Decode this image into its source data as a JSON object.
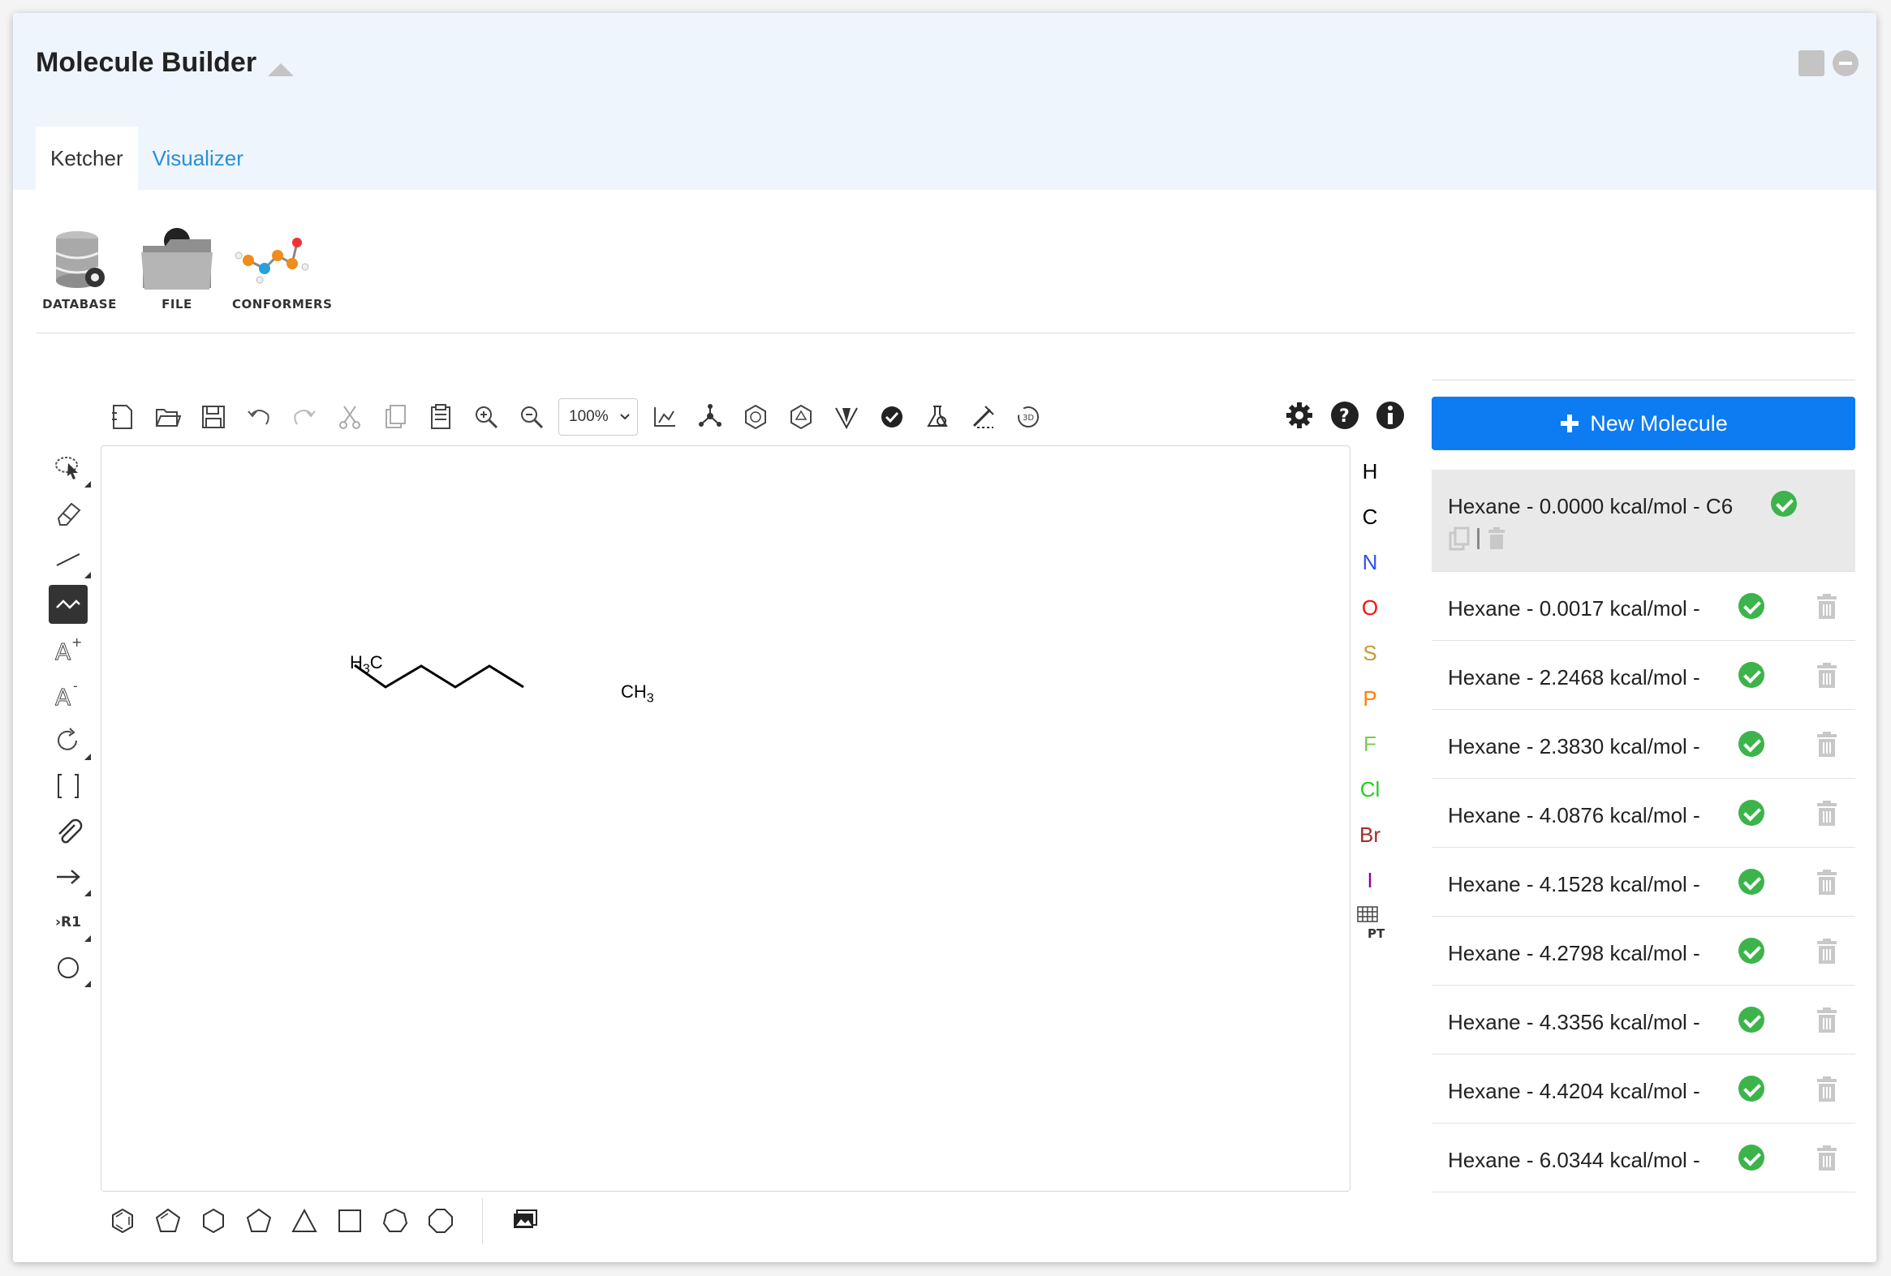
{
  "window": {
    "title": "Molecule Builder"
  },
  "tabs": [
    {
      "label": "Ketcher"
    },
    {
      "label": "Visualizer"
    }
  ],
  "top_icons": [
    {
      "label": "DATABASE"
    },
    {
      "label": "FILE"
    },
    {
      "label": "CONFORMERS"
    }
  ],
  "toolbar": {
    "zoom_value": "100%"
  },
  "canvas": {
    "left_label_main": "H",
    "left_label_sub": "3",
    "left_label_tail": "C",
    "right_label_main": "CH",
    "right_label_sub": "3"
  },
  "left_tools": {
    "rgroup_label": "R1"
  },
  "atoms": [
    {
      "symbol": "H",
      "color": "#000000"
    },
    {
      "symbol": "C",
      "color": "#000000"
    },
    {
      "symbol": "N",
      "color": "#304ff7"
    },
    {
      "symbol": "O",
      "color": "#ff0d0d"
    },
    {
      "symbol": "S",
      "color": "#c99a2e"
    },
    {
      "symbol": "P",
      "color": "#ff8000"
    },
    {
      "symbol": "F",
      "color": "#78cc50"
    },
    {
      "symbol": "Cl",
      "color": "#1fd01f"
    },
    {
      "symbol": "Br",
      "color": "#a62929"
    },
    {
      "symbol": "I",
      "color": "#940094"
    }
  ],
  "periodic_table_label": "PT",
  "panel": {
    "new_button": "New Molecule",
    "molecules": [
      {
        "label": "Hexane - 0.0000 kcal/mol - C6",
        "selected": true
      },
      {
        "label": "Hexane - 0.0017 kcal/mol -"
      },
      {
        "label": "Hexane - 2.2468 kcal/mol -"
      },
      {
        "label": "Hexane - 2.3830 kcal/mol -"
      },
      {
        "label": "Hexane - 4.0876 kcal/mol -"
      },
      {
        "label": "Hexane - 4.1528 kcal/mol -"
      },
      {
        "label": "Hexane - 4.2798 kcal/mol -"
      },
      {
        "label": "Hexane - 4.3356 kcal/mol -"
      },
      {
        "label": "Hexane - 4.4204 kcal/mol -"
      },
      {
        "label": "Hexane - 6.0344 kcal/mol -"
      }
    ]
  }
}
